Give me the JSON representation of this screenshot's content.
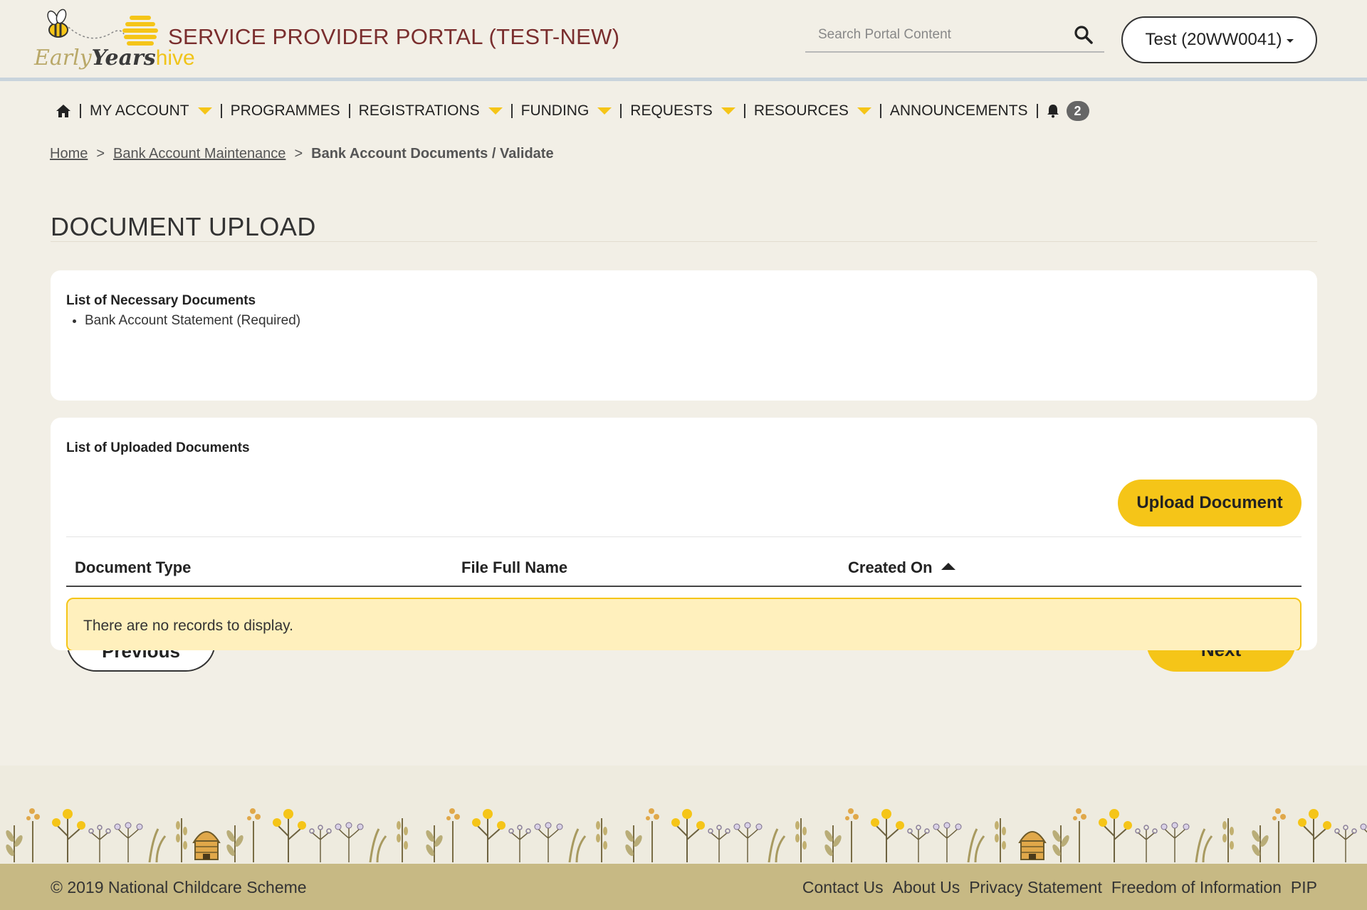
{
  "header": {
    "logo": {
      "early": "Early",
      "years": "Years",
      "hive": "hive"
    },
    "portal_title": "SERVICE PROVIDER PORTAL (TEST-NEW)",
    "search_placeholder": "Search Portal Content",
    "account_label": "Test (20WW0041)"
  },
  "nav": {
    "items": [
      {
        "label": "MY ACCOUNT"
      },
      {
        "label": "PROGRAMMES"
      },
      {
        "label": "REGISTRATIONS"
      },
      {
        "label": "FUNDING"
      },
      {
        "label": "REQUESTS"
      },
      {
        "label": "RESOURCES"
      },
      {
        "label": "ANNOUNCEMENTS"
      }
    ],
    "notification_count": "2"
  },
  "breadcrumb": {
    "home": "Home",
    "bank_maintenance": "Bank Account Maintenance",
    "current": "Bank Account Documents / Validate",
    "separator": ">"
  },
  "page_title": "DOCUMENT UPLOAD",
  "necessary": {
    "title": "List of Necessary Documents",
    "items": [
      "Bank Account Statement (Required)"
    ]
  },
  "uploaded": {
    "title": "List of Uploaded Documents",
    "upload_button": "Upload Document",
    "columns": [
      "Document Type",
      "File Full Name",
      "Created On"
    ],
    "empty_message": "There are no records to display."
  },
  "pager": {
    "previous": "Previous",
    "next": "Next"
  },
  "footer": {
    "copyright": "© 2019 National Childcare Scheme",
    "links": [
      "Contact Us",
      "About Us",
      "Privacy Statement",
      "Freedom of Information",
      "PIP"
    ]
  },
  "colors": {
    "accent_yellow": "#f5c518",
    "title_maroon": "#7a2e2e",
    "footer_bar": "#c7b984",
    "page_bg": "#f2efe6"
  }
}
